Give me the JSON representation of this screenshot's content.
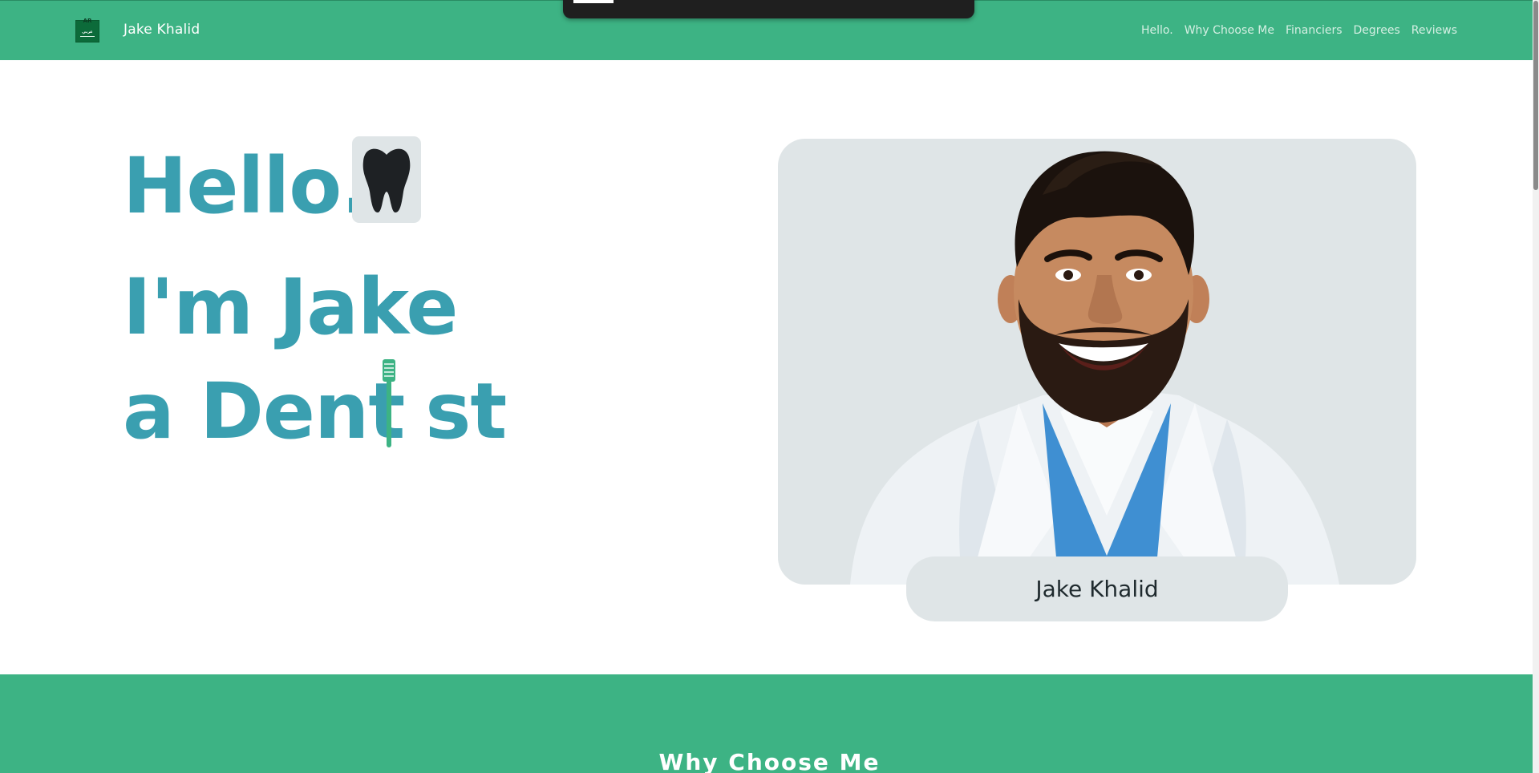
{
  "nav": {
    "brand": "Jake Khalid",
    "lang_flag": {
      "code": "AR",
      "script": "عربي",
      "color": "#0c6b3a"
    },
    "links": [
      {
        "label": "Hello."
      },
      {
        "label": "Why Choose Me"
      },
      {
        "label": "Financiers"
      },
      {
        "label": "Degrees"
      },
      {
        "label": "Reviews"
      }
    ]
  },
  "hero": {
    "line1": "Hello.",
    "line2": "I'm Jake",
    "line3_a": "a Dent",
    "line3_b": "st",
    "tooth_icon": "tooth-icon",
    "brush_icon": "toothbrush-icon"
  },
  "profile": {
    "name": "Jake Khalid",
    "photo": "dentist-portrait"
  },
  "sections": {
    "why_title": "Why Choose Me"
  },
  "colors": {
    "brand_green": "#3db384",
    "hero_teal": "#3a9fb0",
    "card_gray": "#dfe5e7"
  }
}
